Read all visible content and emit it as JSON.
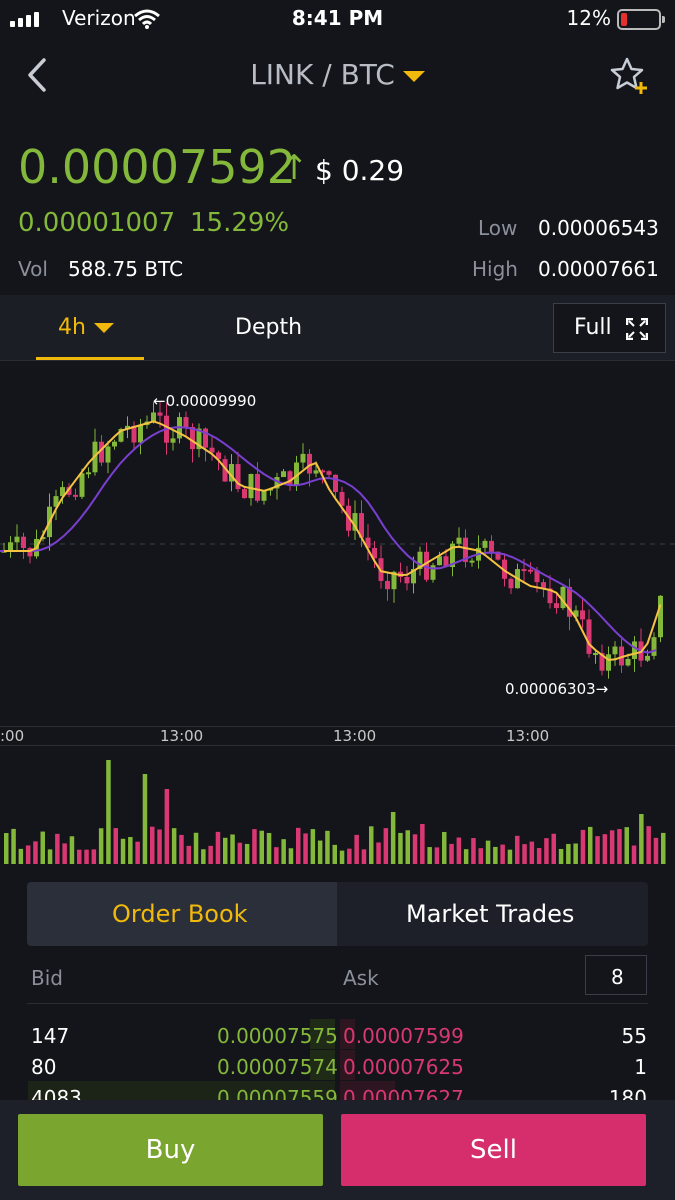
{
  "status_bar": {
    "carrier": "Verizon",
    "time": "8:41 PM",
    "battery": "12%"
  },
  "nav": {
    "title": "LINK / BTC"
  },
  "ticker": {
    "price": "0.00007592",
    "arrow": "↑",
    "usd": "$ 0.29",
    "change": "0.00001007",
    "change_pct": "15.29%",
    "vol_label": "Vol",
    "vol_value": "588.75 BTC",
    "low_label": "Low",
    "low_value": "0.00006543",
    "high_label": "High",
    "high_value": "0.00007661"
  },
  "tabs": {
    "interval": "4h",
    "depth": "Depth",
    "full": "Full"
  },
  "chart_data": {
    "type": "candlestick",
    "high_label": "0.00009990",
    "low_label": "0.00006303",
    "x_ticks": [
      ":00",
      "13:00",
      "13:00",
      "13:00"
    ]
  },
  "order_book": {
    "tab_active": "Order Book",
    "tab_other": "Market Trades",
    "bid_header": "Bid",
    "ask_header": "Ask",
    "depth_value": "8",
    "rows": [
      {
        "bid_qty": "147",
        "bid_price": "0.00007575",
        "ask_price": "0.00007599",
        "ask_qty": "55"
      },
      {
        "bid_qty": "80",
        "bid_price": "0.00007574",
        "ask_price": "0.00007625",
        "ask_qty": "1"
      },
      {
        "bid_qty": "4083",
        "bid_price": "0.00007559",
        "ask_price": "0.00007627",
        "ask_qty": "180"
      }
    ]
  },
  "actions": {
    "buy": "Buy",
    "sell": "Sell"
  },
  "colors": {
    "up": "#84b83a",
    "down": "#d93872",
    "accent": "#f0b90b"
  }
}
